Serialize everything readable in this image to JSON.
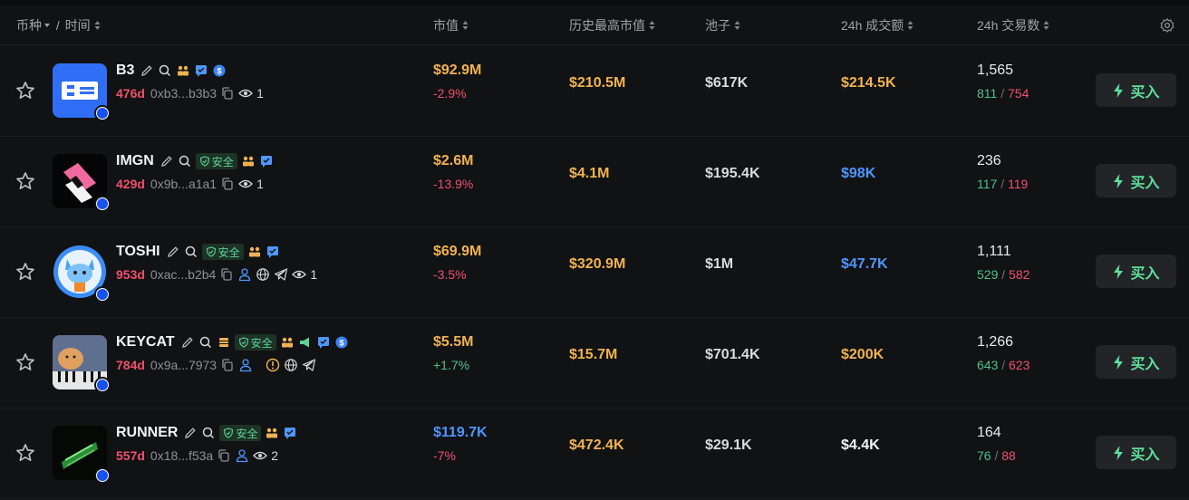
{
  "header": {
    "coin_label": "币种",
    "time_sep": " / ",
    "time_label": "时间",
    "mcap_label": "市值",
    "ath_label": "历史最高市值",
    "pool_label": "池子",
    "vol_label": "24h 成交额",
    "tx_label": "24h 交易数"
  },
  "colors": {
    "gold": "#f0b352",
    "blue": "#4f96ff",
    "red": "#f0506e",
    "green": "#4cc38a",
    "buy": "#5de09a",
    "background": "#111214"
  },
  "buy_label": "买入",
  "safe_label": "安全",
  "rows": [
    {
      "name": "B3",
      "age": "476d",
      "addr": "0xb3...b3b3",
      "holders": "1",
      "mcap": "$92.9M",
      "change": "-2.9%",
      "ath": "$210.5M",
      "pool": "$617K",
      "volume": "$214.5K",
      "tx": "1,565",
      "buys": "811",
      "sells": "754"
    },
    {
      "name": "IMGN",
      "age": "429d",
      "addr": "0x9b...a1a1",
      "holders": "1",
      "mcap": "$2.6M",
      "change": "-13.9%",
      "ath": "$4.1M",
      "pool": "$195.4K",
      "volume": "$98K",
      "tx": "236",
      "buys": "117",
      "sells": "119"
    },
    {
      "name": "TOSHI",
      "age": "953d",
      "addr": "0xac...b2b4",
      "holders": "1",
      "mcap": "$69.9M",
      "change": "-3.5%",
      "ath": "$320.9M",
      "pool": "$1M",
      "volume": "$47.7K",
      "tx": "1,111",
      "buys": "529",
      "sells": "582"
    },
    {
      "name": "KEYCAT",
      "age": "784d",
      "addr": "0x9a...7973",
      "holders": "",
      "mcap": "$5.5M",
      "change": "+1.7%",
      "ath": "$15.7M",
      "pool": "$701.4K",
      "volume": "$200K",
      "tx": "1,266",
      "buys": "643",
      "sells": "623"
    },
    {
      "name": "RUNNER",
      "age": "557d",
      "addr": "0x18...f53a",
      "holders": "2",
      "mcap": "$119.7K",
      "change": "-7%",
      "ath": "$472.4K",
      "pool": "$29.1K",
      "volume": "$4.4K",
      "tx": "164",
      "buys": "76",
      "sells": "88"
    }
  ]
}
